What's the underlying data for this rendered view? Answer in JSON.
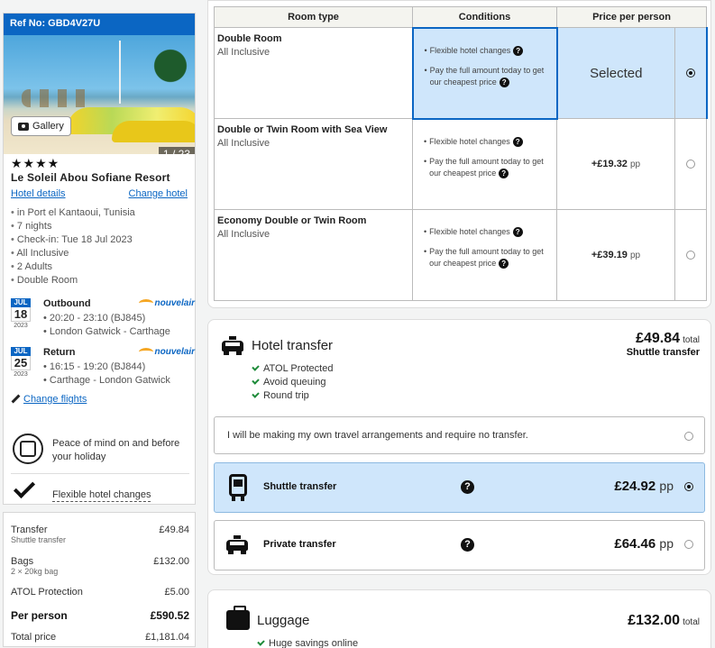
{
  "booking": {
    "ref_label": "Ref No: GBD4V27U",
    "gallery_label": "Gallery",
    "photo_count": "1 / 23",
    "stars": "★★★★",
    "star_rating": 4,
    "hotel_name": "Le Soleil Abou Sofiane Resort",
    "hotel_details_link": "Hotel details",
    "change_hotel_link": "Change hotel",
    "facts": [
      "in Port el Kantaoui, Tunisia",
      "7 nights",
      "Check-in: Tue 18 Jul 2023",
      "All Inclusive",
      "2 Adults",
      "Double Room"
    ]
  },
  "flights": [
    {
      "month": "JUL",
      "day": "18",
      "year": "2023",
      "title": "Outbound",
      "times": "20:20 - 23:10 (BJ845)",
      "route": "London Gatwick - Carthage",
      "airline": "nouvelair"
    },
    {
      "month": "JUL",
      "day": "25",
      "year": "2023",
      "title": "Return",
      "times": "16:15 - 19:20 (BJ844)",
      "route": "Carthage - London Gatwick",
      "airline": "nouvelair"
    }
  ],
  "change_flights_link": "Change flights",
  "peace_text": "Peace of mind on and before your holiday",
  "flex_changes": "Flexible hotel changes",
  "price_summary": [
    {
      "label": "Transfer",
      "sub": "Shuttle transfer",
      "amount": "£49.84"
    },
    {
      "label": "Bags",
      "sub": "2 × 20kg bag",
      "amount": "£132.00"
    },
    {
      "label": "ATOL Protection",
      "sub": "",
      "amount": "£5.00"
    },
    {
      "label": "Per person",
      "sub": "",
      "amount": "£590.52"
    },
    {
      "label": "Total price",
      "sub": "",
      "amount": "£1,181.04"
    }
  ],
  "room_table": {
    "headers": [
      "Room type",
      "Conditions",
      "Price per person"
    ],
    "conditions": [
      "Flexible hotel changes",
      "Pay the full amount today to get our cheapest price"
    ],
    "pp_label": "pp",
    "rows": [
      {
        "name": "Double Room",
        "board": "All Inclusive",
        "price": "Selected",
        "selected": true
      },
      {
        "name": "Double or Twin Room with Sea View",
        "board": "All Inclusive",
        "price": "+£19.32",
        "selected": false
      },
      {
        "name": "Economy Double or Twin Room",
        "board": "All Inclusive",
        "price": "+£39.19",
        "selected": false
      }
    ]
  },
  "transfer": {
    "title": "Hotel transfer",
    "total": "£49.84",
    "total_label": "total",
    "total_sub": "Shuttle transfer",
    "benefits": [
      "ATOL Protected",
      "Avoid queuing",
      "Round trip"
    ],
    "no_transfer_text": "I will be making my own travel arrangements and require no transfer.",
    "options": [
      {
        "title": "Shuttle transfer",
        "price": "£24.92",
        "pp": "pp",
        "selected": true
      },
      {
        "title": "Private transfer",
        "price": "£64.46",
        "pp": "pp",
        "selected": false
      }
    ]
  },
  "luggage": {
    "title": "Luggage",
    "total": "£132.00",
    "total_label": "total",
    "benefit": "Huge savings online"
  },
  "colors": {
    "brand_blue": "#0b66c3",
    "selected_bg": "#cfe6fb",
    "tick_green": "#1e8b3a"
  }
}
